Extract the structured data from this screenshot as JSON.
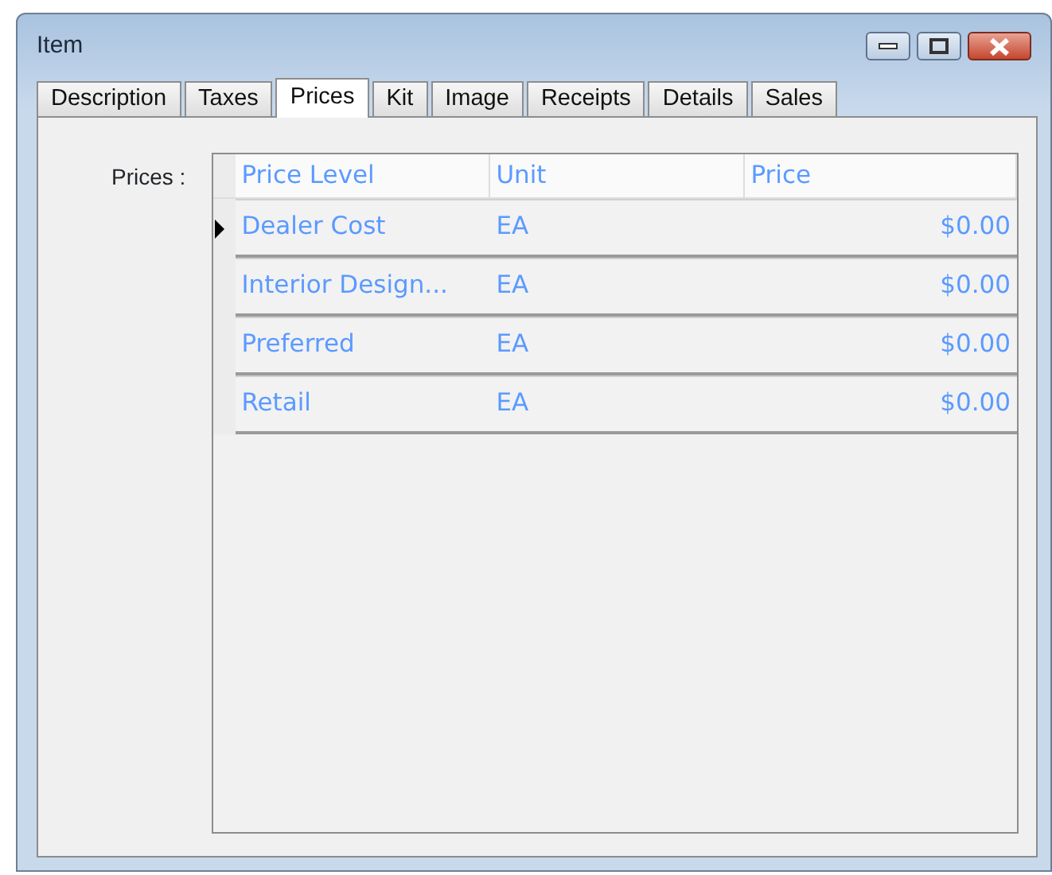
{
  "window": {
    "title": "Item"
  },
  "tabs": [
    {
      "label": "Description",
      "selected": false
    },
    {
      "label": "Taxes",
      "selected": false
    },
    {
      "label": "Prices",
      "selected": true
    },
    {
      "label": "Kit",
      "selected": false
    },
    {
      "label": "Image",
      "selected": false
    },
    {
      "label": "Receipts",
      "selected": false
    },
    {
      "label": "Details",
      "selected": false
    },
    {
      "label": "Sales",
      "selected": false
    }
  ],
  "prices_label": "Prices :",
  "table": {
    "columns": [
      "Price Level",
      "Unit",
      "Price"
    ],
    "rows": [
      {
        "cells": [
          "Dealer Cost",
          "EA",
          "$0.00"
        ],
        "selected": true
      },
      {
        "cells": [
          "Interior Design...",
          "EA",
          "$0.00"
        ],
        "selected": false
      },
      {
        "cells": [
          "Preferred",
          "EA",
          "$0.00"
        ],
        "selected": false
      },
      {
        "cells": [
          "Retail",
          "EA",
          "$0.00"
        ],
        "selected": false
      }
    ]
  }
}
